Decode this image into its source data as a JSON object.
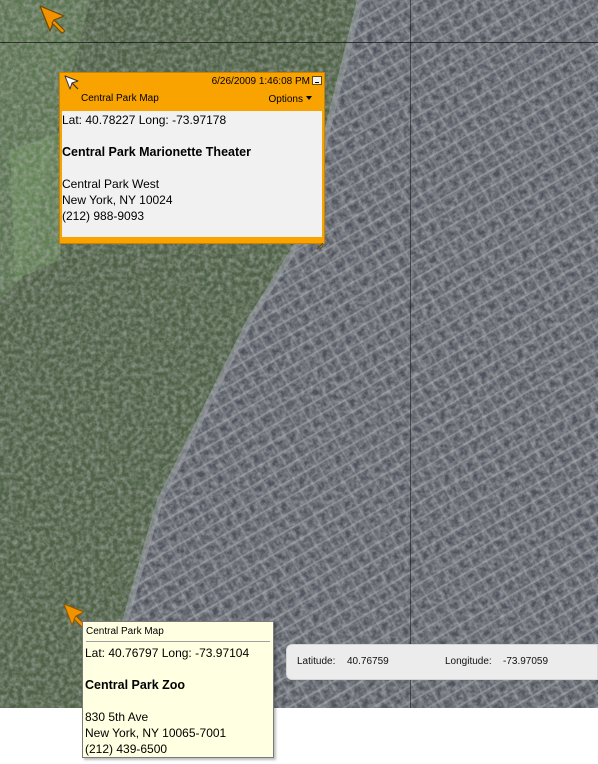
{
  "map": {
    "type": "satellite",
    "colors": {
      "park": "#57684f",
      "city": "#6c7077",
      "building": "#8e9196"
    }
  },
  "top_pin": {
    "icon": "location-pin-icon",
    "color": "#f39200"
  },
  "popup_orange": {
    "datetime": "6/26/2009 1:46:08 PM",
    "title": "Central Park Map",
    "options_label": "Options",
    "lat_long": "Lat: 40.78227 Long: -73.97178",
    "name": "Central Park Marionette Theater",
    "street": "Central Park West",
    "city_line": "New York, NY 10024",
    "phone": "(212) 988-9093",
    "colors": {
      "frame": "#f9a300",
      "body": "#f1f1f1"
    }
  },
  "popup_yellow": {
    "title": "Central Park Map",
    "lat_long": "Lat: 40.76797 Long: -73.97104",
    "name": "Central Park Zoo",
    "street": "830 5th Ave",
    "city_line": "New York, NY 10065-7001",
    "phone": "(212) 439-6500",
    "colors": {
      "background": "#ffffe1"
    }
  },
  "coord_readout": {
    "latitude_label": "Latitude:",
    "latitude_value": "40.76759",
    "longitude_label": "Longitude:",
    "longitude_value": "-73.97059"
  }
}
